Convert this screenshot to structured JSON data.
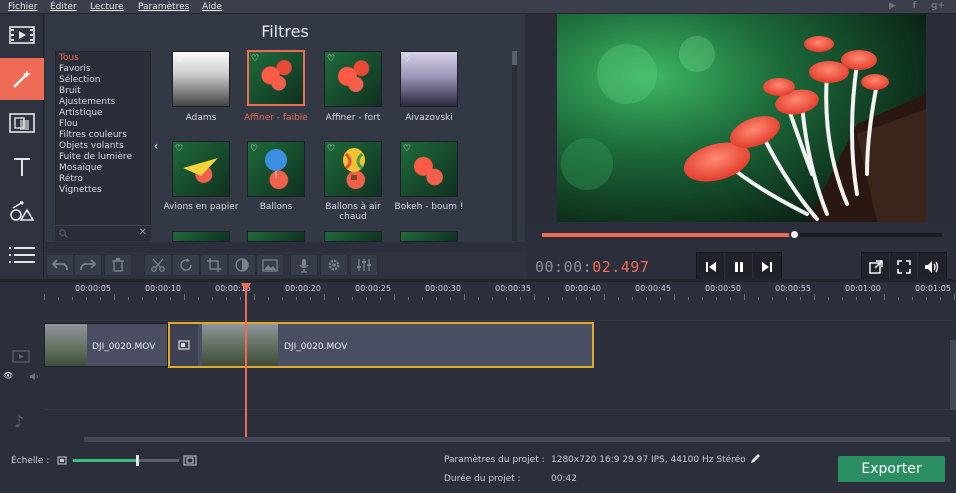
{
  "menu": [
    "Fichier",
    "Éditer",
    "Lecture",
    "Paramètres",
    "Aide"
  ],
  "social_icons": [
    "youtube-icon",
    "facebook-icon",
    "google-plus-icon"
  ],
  "sidebar": [
    "video-icon",
    "magic-wand-icon",
    "transition-icon",
    "text-icon",
    "shapes-icon",
    "list-icon"
  ],
  "filters_panel": {
    "title": "Filtres",
    "categories": [
      "Tous",
      "Favoris",
      "Sélection",
      "Bruit",
      "Ajustements",
      "Artistique",
      "Flou",
      "Filtres couleurs",
      "Objets volants",
      "Fuite de lumière",
      "Mosaïque",
      "Rétro",
      "Vignettes"
    ],
    "selected_category": "Tous",
    "filters": [
      {
        "label": "Adams"
      },
      {
        "label": "Affiner - faible",
        "selected": true
      },
      {
        "label": "Affiner - fort"
      },
      {
        "label": "Aivazovski"
      },
      {
        "label": "Avions en papier"
      },
      {
        "label": "Ballons"
      },
      {
        "label": "Ballons à air chaud"
      },
      {
        "label": "Bokeh - boum !"
      }
    ]
  },
  "playback": {
    "timecode_prefix": "00:00:",
    "timecode_value": "02.497",
    "seek_progress": 0.63
  },
  "timeline": {
    "ruler": [
      "00:00:05",
      "00:00:10",
      "00:00:15",
      "00:00:20",
      "00:00:25",
      "00:00:30",
      "00:00:35",
      "00:00:40",
      "00:00:45",
      "00:00:50",
      "00:00:55",
      "00:01:00",
      "00:01:05"
    ],
    "clips": [
      {
        "name": "DJI_0020.MOV"
      },
      {
        "name": "DJI_0020.MOV",
        "selected": true
      }
    ]
  },
  "footer": {
    "scale_label": "Échelle :",
    "zoom_level": 0.6,
    "project_params_label": "Paramètres du projet :",
    "project_params_value": "1280x720 16:9 29.97 IPS, 44100 Hz Stéréo",
    "project_duration_label": "Durée du projet :",
    "project_duration_value": "00:42",
    "export_label": "Exporter"
  },
  "colors": {
    "accent": "#ee6b55",
    "export": "#2b8e63",
    "selection": "#e0a92b"
  }
}
